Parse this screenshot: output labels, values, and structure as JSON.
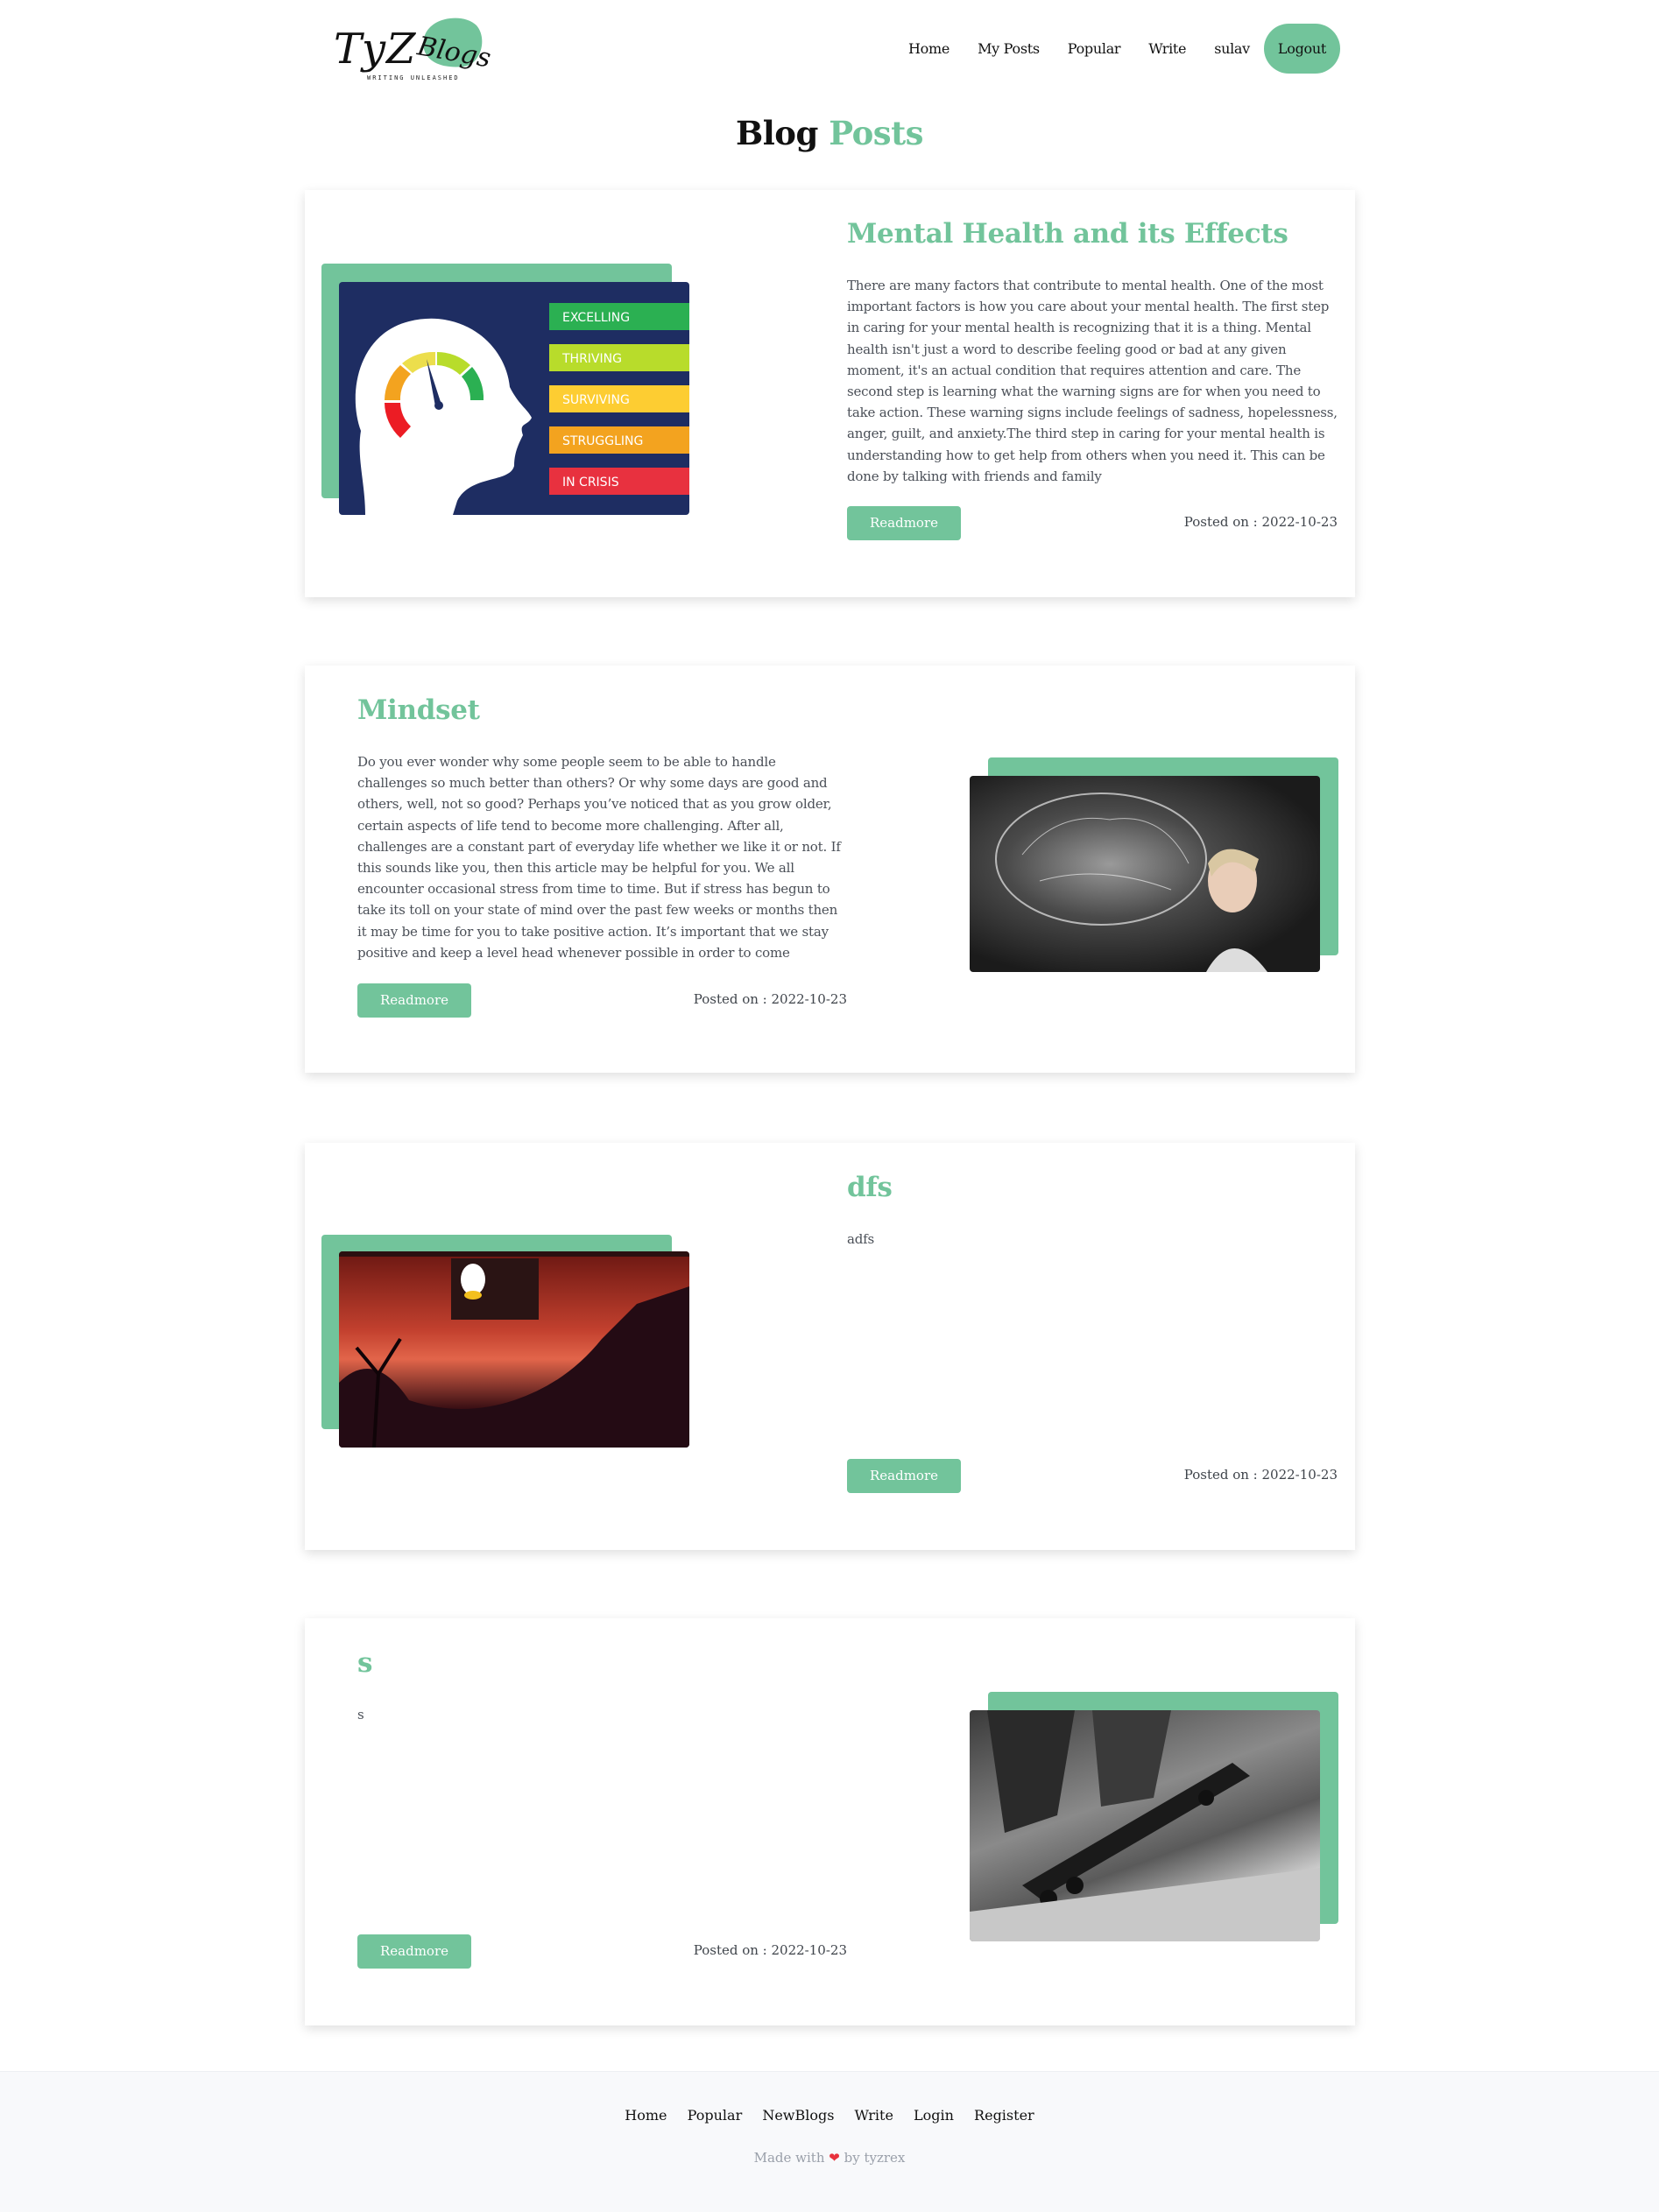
{
  "brand": {
    "logo_text": "Ty Z Blogs",
    "tagline": "WRITING UNLEASHED",
    "accent": "#72c49b"
  },
  "nav": {
    "items": [
      "Home",
      "My Posts",
      "Popular",
      "Write",
      "sulav"
    ],
    "logout": "Logout"
  },
  "page": {
    "title_part1": "Blog",
    "title_part2": "Posts"
  },
  "posts": [
    {
      "title": "Mental Health and its Effects",
      "body": "There are many factors that contribute to mental health. One of the most important factors is how you care about your mental health. The first step in caring for your mental health is recognizing that it is a thing. Mental health isn't just a word to describe feeling good or bad at any given moment, it's an actual condition that requires attention and care. The second step is learning what the warning signs are for when you need to take action. These warning signs include feelings of sadness, hopelessness, anger, guilt, and anxiety.The third step in caring for your mental health is understanding how to get help from others when you need it. This can be done by talking with friends and family",
      "readmore": "Readmore",
      "date": "Posted on : 2022-10-23",
      "image_labels": [
        "EXCELLING",
        "THRIVING",
        "SURVIVING",
        "STRUGGLING",
        "IN CRISIS"
      ]
    },
    {
      "title": "Mindset",
      "body": "Do you ever wonder why some people seem to be able to handle challenges so much better than others? Or why some days are good and others, well, not so good? Perhaps you’ve noticed that as you grow older, certain aspects of life tend to become more challenging. After all, challenges are a constant part of everyday life whether we like it or not. If this sounds like you, then this article may be helpful for you. We all encounter occasional stress from time to time. But if stress has begun to take its toll on your state of mind over the past few weeks or months then it may be time for you to take positive action. It’s important that we stay positive and keep a level head whenever possible in order to come",
      "readmore": "Readmore",
      "date": "Posted on : 2022-10-23"
    },
    {
      "title": "dfs",
      "body": "adfs",
      "readmore": "Readmore",
      "date": "Posted on : 2022-10-23"
    },
    {
      "title": "s",
      "body": "s",
      "readmore": "Readmore",
      "date": "Posted on : 2022-10-23"
    }
  ],
  "footer": {
    "links": [
      "Home",
      "Popular",
      "NewBlogs",
      "Write",
      "Login",
      "Register"
    ],
    "made_prefix": "Made with",
    "heart": "❤",
    "made_suffix": "by tyzrex"
  }
}
